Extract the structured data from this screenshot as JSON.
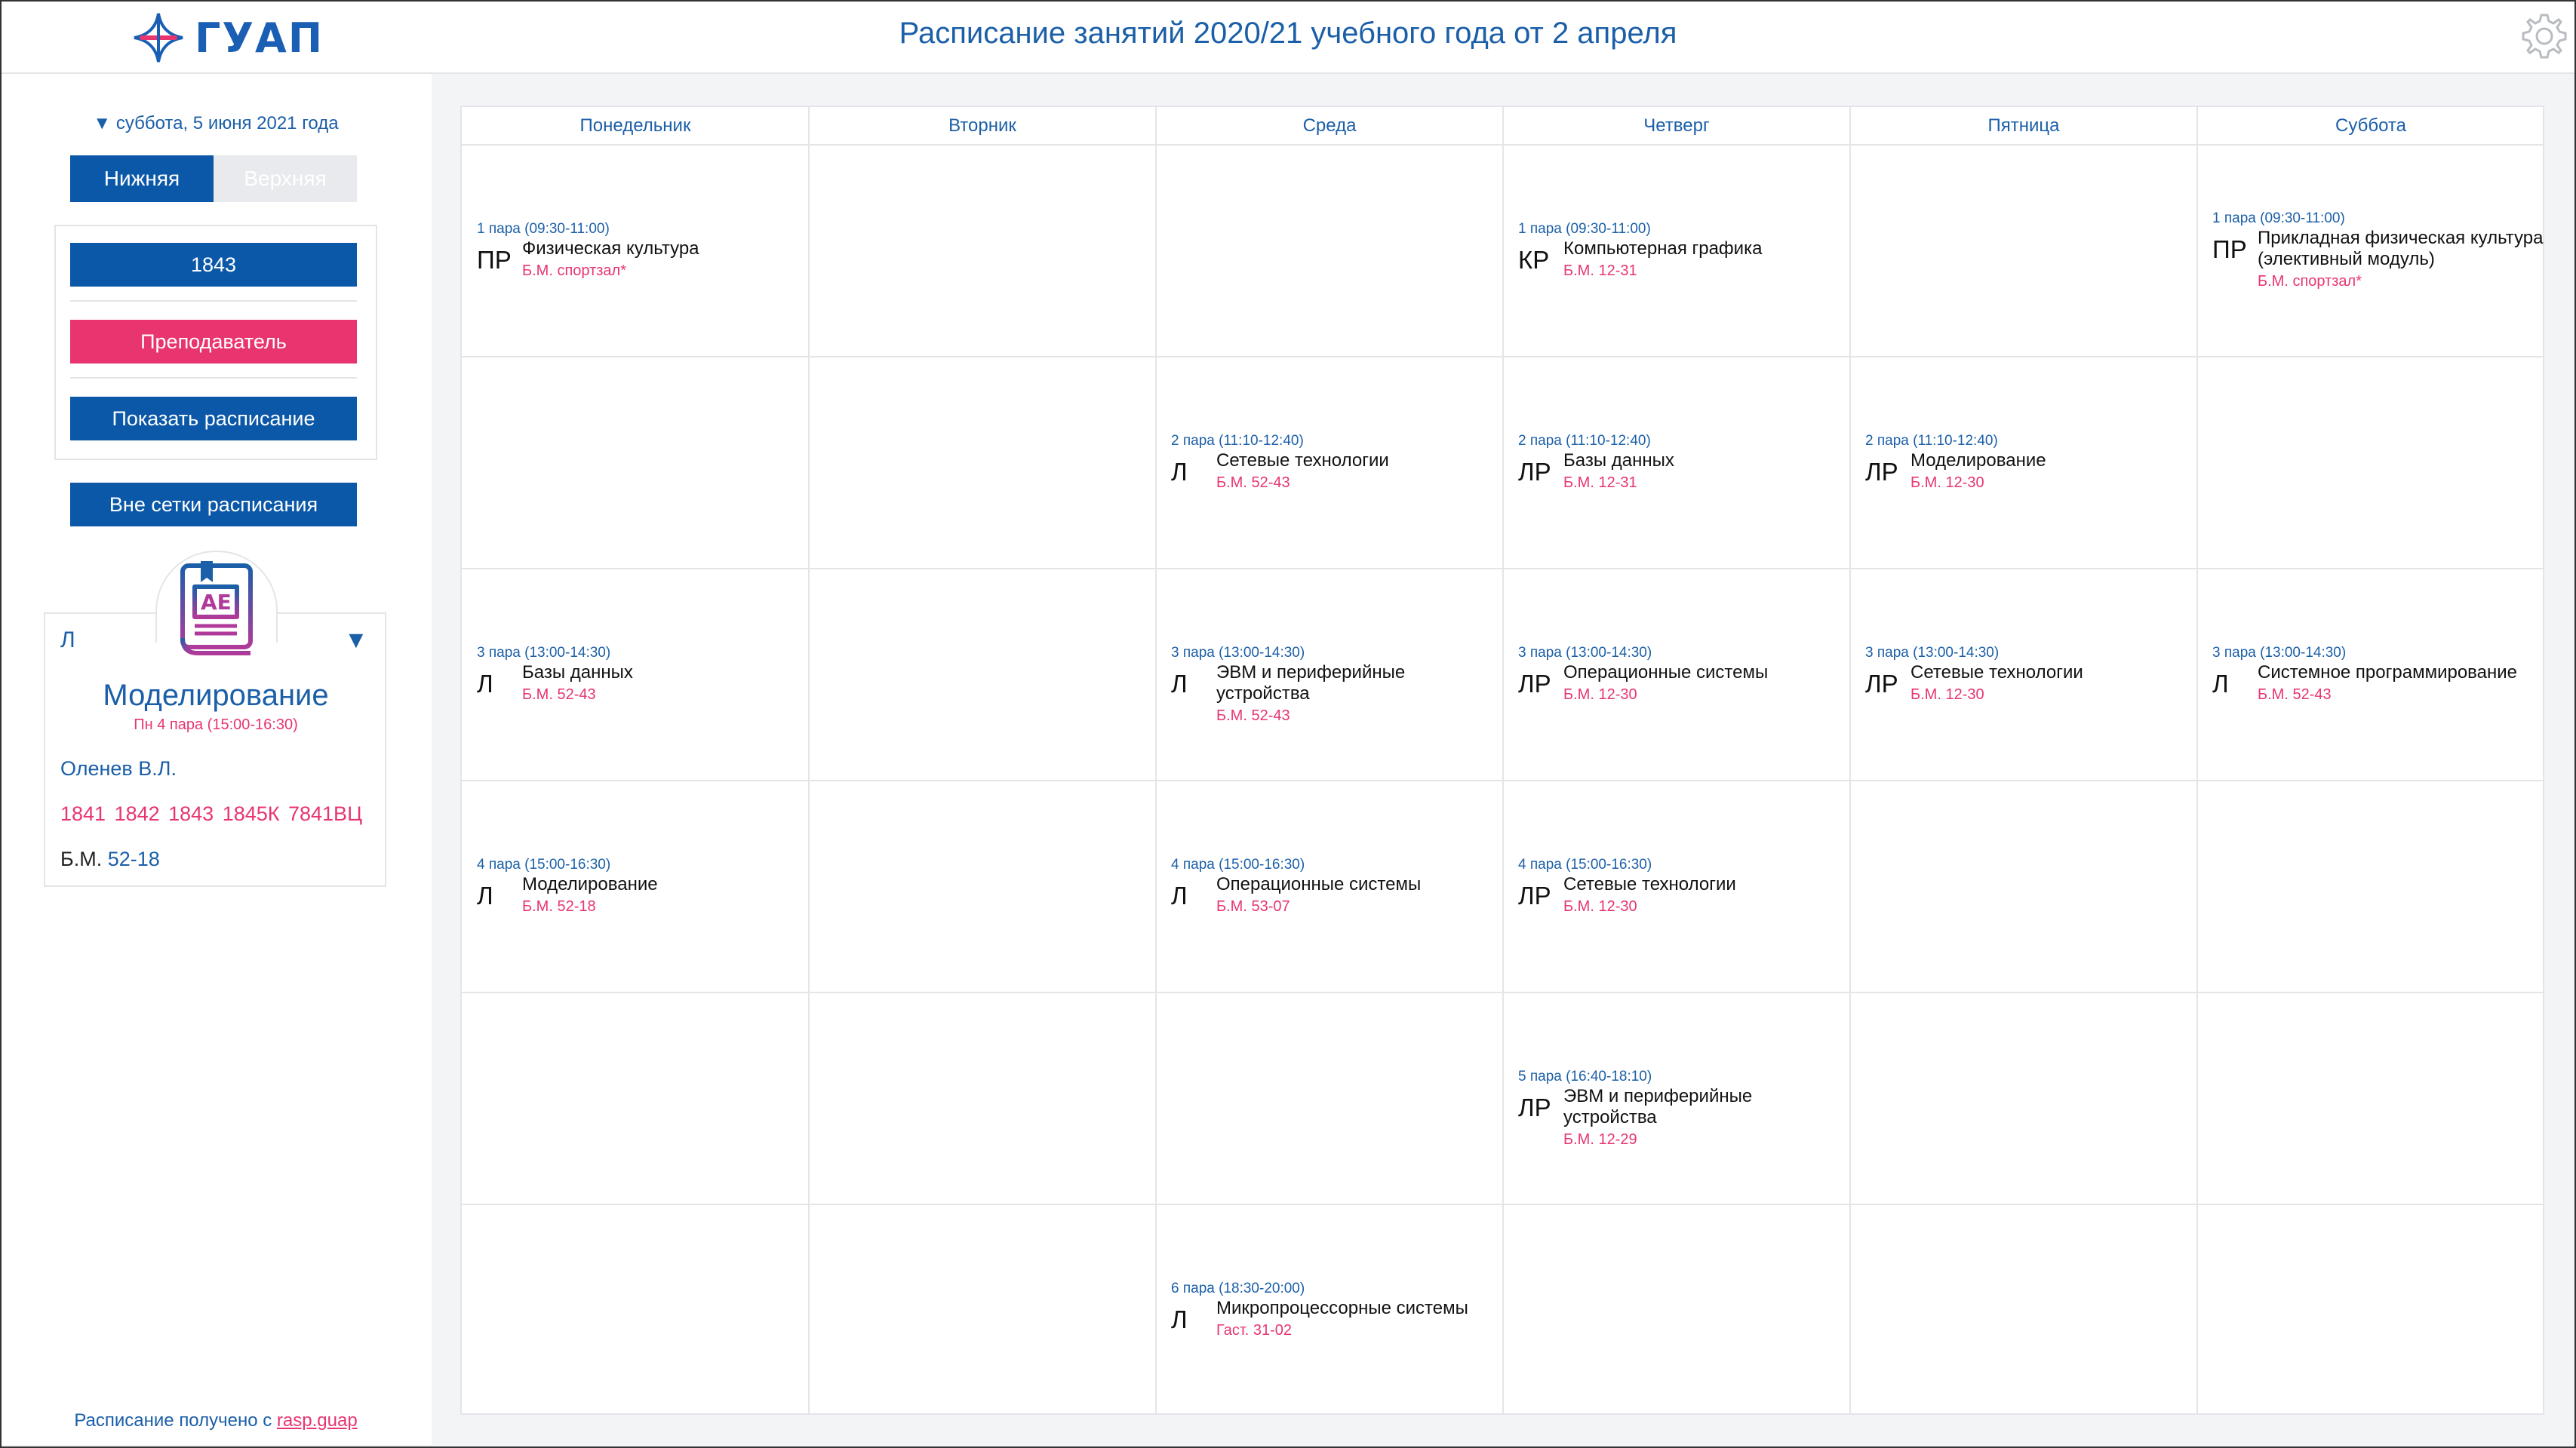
{
  "header": {
    "logo_text": "ГУАП",
    "title": "Расписание занятий 2020/21 учебного года от 2 апреля",
    "settings_icon": "gear-icon"
  },
  "sidebar": {
    "date_label": "▼ суббота, 5 июня 2021 года",
    "week_lower": "Нижняя",
    "week_upper": "Верхняя",
    "group_button": "1843",
    "teacher_button": "Преподаватель",
    "show_button": "Показать расписание",
    "offgrid_button": "Вне сетки расписания",
    "card": {
      "type": "Л",
      "arrow": "▼",
      "subject": "Моделирование",
      "time": "Пн 4 пара (15:00-16:30)",
      "teacher": "Оленев В.Л.",
      "groups": "1841 1842 1843 1845К 7841ВЦ",
      "building": "Б.М.",
      "room": "52-18"
    },
    "footer_prefix": "Расписание получено с ",
    "footer_link": "rasp.guap"
  },
  "colors": {
    "primary": "#0b58a8",
    "accent_pink": "#e8356f",
    "text_blue": "#1b5fa8",
    "border": "#e3e5e8"
  },
  "days": [
    "Понедельник",
    "Вторник",
    "Среда",
    "Четверг",
    "Пятница",
    "Суббота"
  ],
  "lessons": [
    {
      "day": 0,
      "slot": 0,
      "time": "1 пара (09:30-11:00)",
      "type": "ПР",
      "subject": "Физическая культура",
      "room": "Б.М. спортзал*"
    },
    {
      "day": 3,
      "slot": 0,
      "time": "1 пара (09:30-11:00)",
      "type": "КР",
      "subject": "Компьютерная графика",
      "room": "Б.М. 12-31"
    },
    {
      "day": 5,
      "slot": 0,
      "time": "1 пара (09:30-11:00)",
      "type": "ПР",
      "subject": "Прикладная физическая культура (элективный модуль)",
      "room": "Б.М. спортзал*"
    },
    {
      "day": 2,
      "slot": 1,
      "time": "2 пара (11:10-12:40)",
      "type": "Л",
      "subject": "Сетевые технологии",
      "room": "Б.М. 52-43"
    },
    {
      "day": 3,
      "slot": 1,
      "time": "2 пара (11:10-12:40)",
      "type": "ЛР",
      "subject": "Базы данных",
      "room": "Б.М. 12-31"
    },
    {
      "day": 4,
      "slot": 1,
      "time": "2 пара (11:10-12:40)",
      "type": "ЛР",
      "subject": "Моделирование",
      "room": "Б.М. 12-30"
    },
    {
      "day": 0,
      "slot": 2,
      "time": "3 пара (13:00-14:30)",
      "type": "Л",
      "subject": "Базы данных",
      "room": "Б.М. 52-43"
    },
    {
      "day": 2,
      "slot": 2,
      "time": "3 пара (13:00-14:30)",
      "type": "Л",
      "subject": "ЭВМ и периферийные устройства",
      "room": "Б.М. 52-43"
    },
    {
      "day": 3,
      "slot": 2,
      "time": "3 пара (13:00-14:30)",
      "type": "ЛР",
      "subject": "Операционные системы",
      "room": "Б.М. 12-30"
    },
    {
      "day": 4,
      "slot": 2,
      "time": "3 пара (13:00-14:30)",
      "type": "ЛР",
      "subject": "Сетевые технологии",
      "room": "Б.М. 12-30"
    },
    {
      "day": 5,
      "slot": 2,
      "time": "3 пара (13:00-14:30)",
      "type": "Л",
      "subject": "Системное программирование",
      "room": "Б.М. 52-43"
    },
    {
      "day": 0,
      "slot": 3,
      "time": "4 пара (15:00-16:30)",
      "type": "Л",
      "subject": "Моделирование",
      "room": "Б.М. 52-18"
    },
    {
      "day": 2,
      "slot": 3,
      "time": "4 пара (15:00-16:30)",
      "type": "Л",
      "subject": "Операционные системы",
      "room": "Б.М. 53-07"
    },
    {
      "day": 3,
      "slot": 3,
      "time": "4 пара (15:00-16:30)",
      "type": "ЛР",
      "subject": "Сетевые технологии",
      "room": "Б.М. 12-30"
    },
    {
      "day": 3,
      "slot": 4,
      "time": "5 пара (16:40-18:10)",
      "type": "ЛР",
      "subject": "ЭВМ и периферийные устройства",
      "room": "Б.М. 12-29"
    },
    {
      "day": 2,
      "slot": 5,
      "time": "6 пара (18:30-20:00)",
      "type": "Л",
      "subject": "Микропроцессорные системы",
      "room": "Гаст. 31-02"
    }
  ]
}
